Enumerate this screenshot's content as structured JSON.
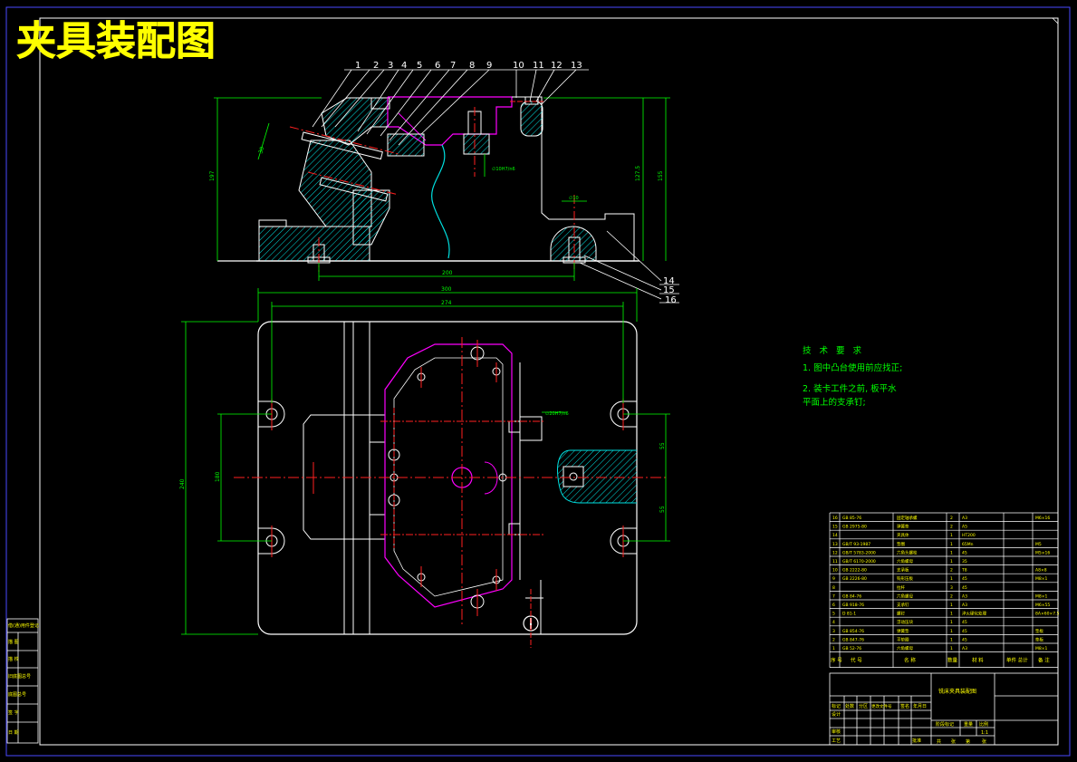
{
  "title": "夹具装配图",
  "balloons": [
    "1",
    "2",
    "3",
    "4",
    "5",
    "6",
    "7",
    "8",
    "9",
    "10",
    "11",
    "12",
    "13",
    "14",
    "15",
    "16"
  ],
  "dimensions": {
    "front_height_left": "197",
    "front_height_right1": "127.5",
    "front_height_right2": "155",
    "front_bottom_span": "200",
    "front_angle_dim": "30",
    "front_small_dim": "∅10H7/n6",
    "front_small_dim2": "∅10",
    "top_overall_width": "300",
    "top_inner_width": "274",
    "top_height": "240",
    "top_left_dim": "180",
    "top_right_dim1": "55",
    "top_right_dim2": "55",
    "top_hole_dim": "∅20H7/n6"
  },
  "notes": {
    "heading": "技 术 要 求",
    "lines": [
      "1. 图中凸台使用前应找正;",
      "2. 装卡工件之前, 板平水",
      "平面上的支承钉;"
    ]
  },
  "parts_table": {
    "rows": [
      {
        "no": "16",
        "code": "GB 85-76",
        "name": "固定轴承螺",
        "qty": "2",
        "material": "A3",
        "note": "M6×16"
      },
      {
        "no": "15",
        "code": "GB 2975-80",
        "name": "弹簧垫",
        "qty": "2",
        "material": "A5",
        "note": ""
      },
      {
        "no": "14",
        "code": "",
        "name": "夹具体",
        "qty": "1",
        "material": "HT200",
        "note": ""
      },
      {
        "no": "13",
        "code": "GB/T 93-1987",
        "name": "垫圈",
        "qty": "1",
        "material": "65Mn",
        "note": "M5"
      },
      {
        "no": "12",
        "code": "GB/T 5783-2000",
        "name": "六角头螺栓",
        "qty": "1",
        "material": "45",
        "note": "M5×16"
      },
      {
        "no": "11",
        "code": "GB/T 6170-2000",
        "name": "六角螺母",
        "qty": "1",
        "material": "35",
        "note": ""
      },
      {
        "no": "10",
        "code": "GB 2222-80",
        "name": "支承板",
        "qty": "2",
        "material": "T8",
        "note": "A8×8"
      },
      {
        "no": "9",
        "code": "GB 2226-80",
        "name": "钩形压板",
        "qty": "1",
        "material": "45",
        "note": "M8×1"
      },
      {
        "no": "8",
        "code": "",
        "name": "拉杆",
        "qty": "3",
        "material": "45",
        "note": ""
      },
      {
        "no": "7",
        "code": "GB 84-76",
        "name": "六角螺母",
        "qty": "2",
        "material": "A3",
        "note": "M8×1"
      },
      {
        "no": "6",
        "code": "GB 918-76",
        "name": "支承钉",
        "qty": "1",
        "material": "A3",
        "note": "M6×55"
      },
      {
        "no": "5",
        "code": "D 81-1",
        "name": "螺钉",
        "qty": "1",
        "material": "淬火硬化处理",
        "note": "8A×60×7.5"
      },
      {
        "no": "4",
        "code": "",
        "name": "浮动压块",
        "qty": "1",
        "material": "45",
        "note": ""
      },
      {
        "no": "3",
        "code": "GB 854-76",
        "name": "弹簧垫",
        "qty": "1",
        "material": "45",
        "note": "垫板"
      },
      {
        "no": "2",
        "code": "GB 847-76",
        "name": "平垫圈",
        "qty": "1",
        "material": "45",
        "note": "垫板"
      },
      {
        "no": "1",
        "code": "GB 52-76",
        "name": "六角螺母",
        "qty": "1",
        "material": "A3",
        "note": "M8×1"
      }
    ],
    "header": [
      "序 号",
      "代 号",
      "名 称",
      "数量",
      "材 料",
      "单件 总计",
      "备 注"
    ],
    "drawing_name": "铣床夹具装配图",
    "bottom_labels": [
      "标记",
      "处数",
      "分区",
      "更改文件号",
      "签名",
      "年月日"
    ],
    "stage_labels": [
      "阶段标记",
      "重量",
      "比例"
    ],
    "sheet_labels": [
      "共",
      "张",
      "第",
      "张"
    ],
    "role_labels": [
      "设计",
      "审核",
      "工艺",
      "批准"
    ],
    "scale": "1:1"
  },
  "side_labels": [
    "借(通)用件登记",
    "描 图",
    "描 校",
    "旧底图总号",
    "底图总号",
    "签 字",
    "日 期"
  ],
  "colors": {
    "line": "#ffffff",
    "dimension": "#00ff00",
    "center": "#ff2020",
    "workpiece": "#ff00ff",
    "section": "#00e0e0",
    "title": "#ffff00",
    "border": "#4a4aff"
  }
}
